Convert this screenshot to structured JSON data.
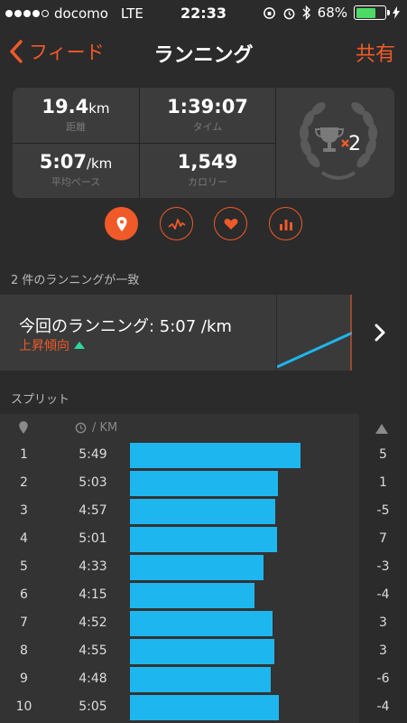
{
  "status_bar": {
    "carrier": "docomo",
    "network": "LTE",
    "time": "22:33",
    "battery": "68%",
    "battery_level": 0.68
  },
  "nav": {
    "back_label": "フィード",
    "title": "ランニング",
    "share_label": "共有"
  },
  "stats": {
    "distance": {
      "value": "19.4",
      "unit": "km",
      "label": "距離"
    },
    "time": {
      "value": "1:39:07",
      "label": "タイム"
    },
    "pace": {
      "value": "5:07",
      "unit": "/km",
      "label": "平均ペース"
    },
    "calories": {
      "value": "1,549",
      "label": "カロリー"
    },
    "trophy_count": "2"
  },
  "tabs": [
    "map-pin-icon",
    "pace-chart-icon",
    "heart-rate-icon",
    "bar-chart-icon"
  ],
  "match_text": "2 件のランニングが一致",
  "comparison": {
    "title": "今回のランニング: 5:07 /km",
    "trend_label": "上昇傾向"
  },
  "splits_title": "スプリット",
  "splits_header": {
    "pace_unit": "/ KM"
  },
  "colors": {
    "accent": "#f05a28",
    "bar": "#1eb6ee",
    "trend": "#2fd5a0"
  },
  "splits": [
    {
      "num": "1",
      "pace": "5:49",
      "diff": "5",
      "pace_sec": 349
    },
    {
      "num": "2",
      "pace": "5:03",
      "diff": "1",
      "pace_sec": 303
    },
    {
      "num": "3",
      "pace": "4:57",
      "diff": "-5",
      "pace_sec": 297
    },
    {
      "num": "4",
      "pace": "5:01",
      "diff": "7",
      "pace_sec": 301
    },
    {
      "num": "5",
      "pace": "4:33",
      "diff": "-3",
      "pace_sec": 273
    },
    {
      "num": "6",
      "pace": "4:15",
      "diff": "-4",
      "pace_sec": 255
    },
    {
      "num": "7",
      "pace": "4:52",
      "diff": "3",
      "pace_sec": 292
    },
    {
      "num": "8",
      "pace": "4:55",
      "diff": "3",
      "pace_sec": 295
    },
    {
      "num": "9",
      "pace": "4:48",
      "diff": "-6",
      "pace_sec": 288
    },
    {
      "num": "10",
      "pace": "5:05",
      "diff": "-4",
      "pace_sec": 305
    }
  ]
}
